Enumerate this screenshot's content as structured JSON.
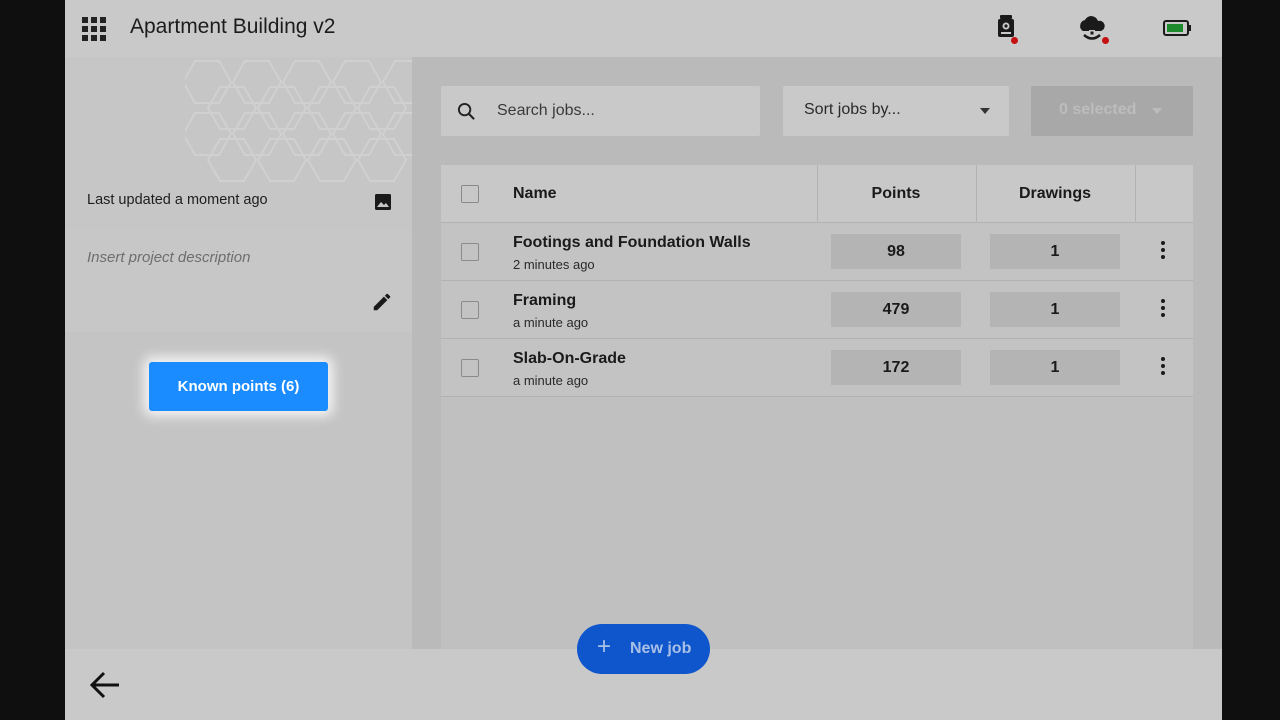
{
  "header": {
    "title": "Apartment Building v2",
    "icons": [
      "apps-grid-icon",
      "total-station-icon",
      "cloud-sync-icon",
      "battery-icon"
    ]
  },
  "project": {
    "last_updated": "Last updated a moment ago",
    "description_placeholder": "Insert project description",
    "known_points_label": "Known points (6)"
  },
  "toolbar": {
    "search_placeholder": "Search jobs...",
    "sort_label": "Sort jobs by...",
    "selected_label": "0 selected"
  },
  "table": {
    "columns": [
      "Name",
      "Points",
      "Drawings"
    ],
    "rows": [
      {
        "name": "Footings and Foundation Walls",
        "time": "2 minutes ago",
        "points": "98",
        "drawings": "1"
      },
      {
        "name": "Framing",
        "time": "a minute ago",
        "points": "479",
        "drawings": "1"
      },
      {
        "name": "Slab-On-Grade",
        "time": "a minute ago",
        "points": "172",
        "drawings": "1"
      }
    ]
  },
  "actions": {
    "new_job_label": "New job"
  },
  "colors": {
    "primary": "#1a8cff",
    "fab": "#0f56cc",
    "status_dot": "#c41010",
    "battery": "#1e8a2e"
  }
}
